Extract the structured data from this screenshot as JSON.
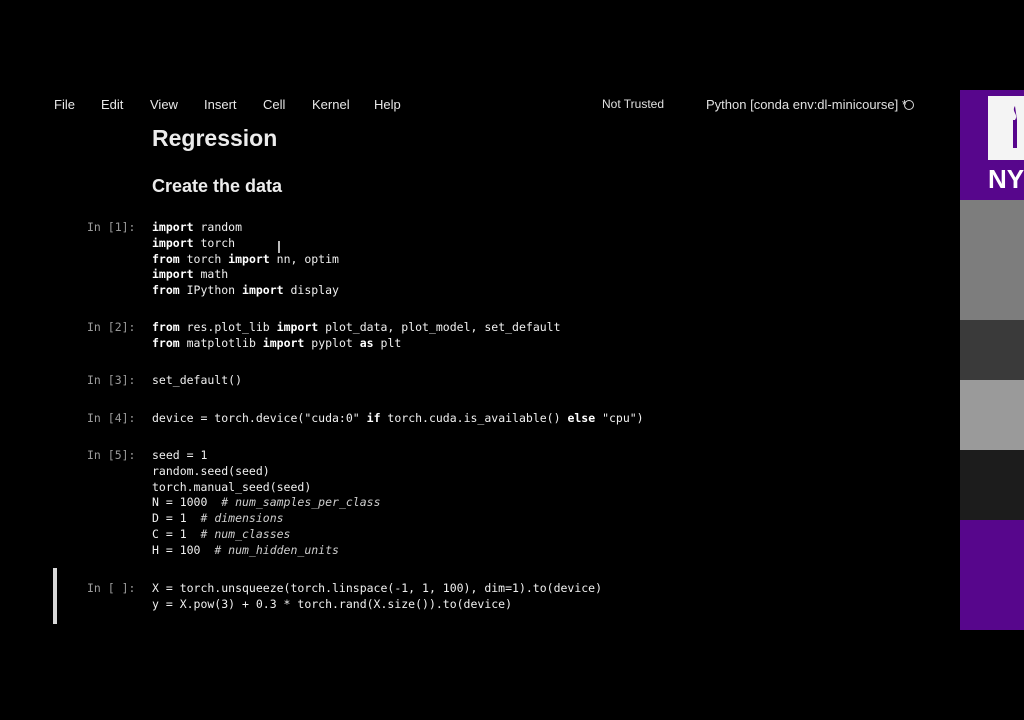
{
  "menu": {
    "items": [
      "File",
      "Edit",
      "View",
      "Insert",
      "Cell",
      "Kernel",
      "Help"
    ],
    "trust_status": "Not Trusted",
    "kernel_name": "Python [conda env:dl-minicourse] *"
  },
  "notebook": {
    "title": "Regression",
    "subtitle": "Create the data"
  },
  "cells": [
    {
      "prompt": "In [1]:",
      "lines": [
        [
          {
            "k": "import",
            "t": " random"
          }
        ],
        [
          {
            "k": "import",
            "t": " torch"
          }
        ],
        [
          {
            "k": "from",
            "t": " torch "
          },
          {
            "k": "import",
            "t": " nn, optim"
          }
        ],
        [
          {
            "k": "import",
            "t": " math"
          }
        ],
        [
          {
            "k": "from",
            "t": " IPython "
          },
          {
            "k": "import",
            "t": " display"
          }
        ]
      ]
    },
    {
      "prompt": "In [2]:",
      "lines": [
        [
          {
            "k": "from",
            "t": " res.plot_lib "
          },
          {
            "k": "import",
            "t": " plot_data, plot_model, set_default"
          }
        ],
        [
          {
            "k": "from",
            "t": " matplotlib "
          },
          {
            "k": "import",
            "t": " pyplot "
          },
          {
            "k": "as",
            "t": " plt"
          }
        ]
      ]
    },
    {
      "prompt": "In [3]:",
      "lines": [
        [
          {
            "t": "set_default()"
          }
        ]
      ]
    },
    {
      "prompt": "In [4]:",
      "lines": [
        [
          {
            "t": "device = torch.device(\"cuda:0\" "
          },
          {
            "k": "if",
            "t": " torch.cuda.is_available() "
          },
          {
            "k": "else",
            "t": " \"cpu\")"
          }
        ]
      ]
    },
    {
      "prompt": "In [5]:",
      "lines": [
        [
          {
            "t": "seed = 1"
          }
        ],
        [
          {
            "t": "random.seed(seed)"
          }
        ],
        [
          {
            "t": "torch.manual_seed(seed)"
          }
        ],
        [
          {
            "t": "N = 1000  "
          },
          {
            "c": "# num_samples_per_class"
          }
        ],
        [
          {
            "t": "D = 1  "
          },
          {
            "c": "# dimensions"
          }
        ],
        [
          {
            "t": "C = 1  "
          },
          {
            "c": "# num_classes"
          }
        ],
        [
          {
            "t": "H = 100  "
          },
          {
            "c": "# num_hidden_units"
          }
        ]
      ]
    },
    {
      "prompt": "In [ ]:",
      "lines": [
        [
          {
            "t": "X = torch.unsqueeze(torch.linspace(-1, 1, 100), dim=1).to(device)"
          }
        ],
        [
          {
            "t": "y = X.pow(3) + 0.3 * torch.rand(X.size()).to(device)"
          }
        ]
      ]
    }
  ],
  "side_logo": {
    "text": "NY",
    "color": "#57068c"
  }
}
